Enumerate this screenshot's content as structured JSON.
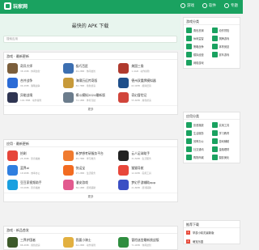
{
  "header": {
    "logo_text": "玩家网",
    "nav": [
      {
        "label": "游戏",
        "icon": "gamepad-icon"
      },
      {
        "label": "软件",
        "icon": "app-icon"
      },
      {
        "label": "专题",
        "icon": "topic-icon"
      }
    ]
  },
  "hero": {
    "title": "最快的 APK 下载",
    "search_placeholder": "搜索应用"
  },
  "sections": [
    {
      "title": "游戏 · 最新更新",
      "more": "更多",
      "apps": [
        {
          "name": "奇异大师",
          "meta": "38.1MB · 休闲益智",
          "color": "#7b5e3b"
        },
        {
          "name": "极巧百匠",
          "meta": "49.2MB · 休闲益智",
          "color": "#3c6fb1"
        },
        {
          "name": "美国三角",
          "meta": "1.4GB · 动作冒险",
          "color": "#b03a2e"
        },
        {
          "name": "合并战争",
          "meta": "96.2MB · 策略战争",
          "color": "#2b6bd6"
        },
        {
          "name": "海啸历远传奇版",
          "meta": "82.7MB · 角色扮演",
          "color": "#c79a3a"
        },
        {
          "name": "德州双重牌模拟器",
          "meta": "62.0MB · 模拟经营",
          "color": "#1f4f8a"
        },
        {
          "name": "异能战境",
          "meta": "102.3MB · 动作冒险",
          "color": "#2f3552"
        },
        {
          "name": "模斗模拟2024最新版",
          "meta": "74.1MB · 体育竞技",
          "color": "#6b7c8c"
        },
        {
          "name": "奇幻冒险记",
          "meta": "55.6MB · 角色扮演",
          "color": "#d1453b"
        }
      ]
    },
    {
      "title": "应用 · 最新更新",
      "more": "更多",
      "apps": [
        {
          "name": "拾刷",
          "meta": "25.3MB · 影音播放",
          "color": "#e6463a"
        },
        {
          "name": "新梦想考研服务平台",
          "meta": "45.7MB · 学习教育",
          "color": "#f07b2f"
        },
        {
          "name": "云人足球助手",
          "meta": "31.5MB · 生活服务",
          "color": "#222222"
        },
        {
          "name": "蓝界ai",
          "meta": "18.9MB · 效率办公",
          "color": "#2f7fe0"
        },
        {
          "name": "快运宝",
          "meta": "27.2MB · 生活服务",
          "color": "#f26b21"
        },
        {
          "name": "猫猫导航",
          "meta": "12.4MB · 实用工具",
          "color": "#e8473b"
        },
        {
          "name": "豆豆家视频助手",
          "meta": "33.0MB · 影音播放",
          "color": "#1aa0e0"
        },
        {
          "name": "潘安游戏",
          "meta": "56.1MB · 游戏辅助",
          "color": "#e25a8f"
        },
        {
          "name": "梦幻手游辅助app",
          "meta": "21.8MB · 游戏辅助",
          "color": "#3b4fc4"
        }
      ]
    },
    {
      "title": "游戏 · 新品首发",
      "more": "更多",
      "apps": [
        {
          "name": "三界护国者",
          "meta": "88.4MB · 角色扮演",
          "color": "#3d5a2a"
        },
        {
          "name": "我要小骑士",
          "meta": "64.2MB · 动作冒险",
          "color": "#e2b040"
        },
        {
          "name": "冒险迷宫最新挑战版",
          "meta": "71.9MB · 休闲益智",
          "color": "#2f8e3f"
        }
      ]
    }
  ],
  "sidebar": {
    "game_cats_title": "游戏分类",
    "game_cats": [
      "角色扮演",
      "动作冒险",
      "休闲益智",
      "棋牌游戏",
      "策略战争",
      "体育竞技",
      "模拟经营",
      "赛车游戏",
      "网络游戏"
    ],
    "app_cats_title": "应用分类",
    "app_cats": [
      "影音播放",
      "实用工具",
      "生活服务",
      "学习教育",
      "效率办公",
      "游戏辅助",
      "社交通讯",
      "金融理财",
      "购物商城",
      "摄影美化"
    ],
    "ranking_title": "推荐下载",
    "ranking": [
      {
        "rank": "1",
        "name": "掌游小精灵最新版"
      },
      {
        "rank": "2",
        "name": "萌宠乐园"
      }
    ]
  }
}
